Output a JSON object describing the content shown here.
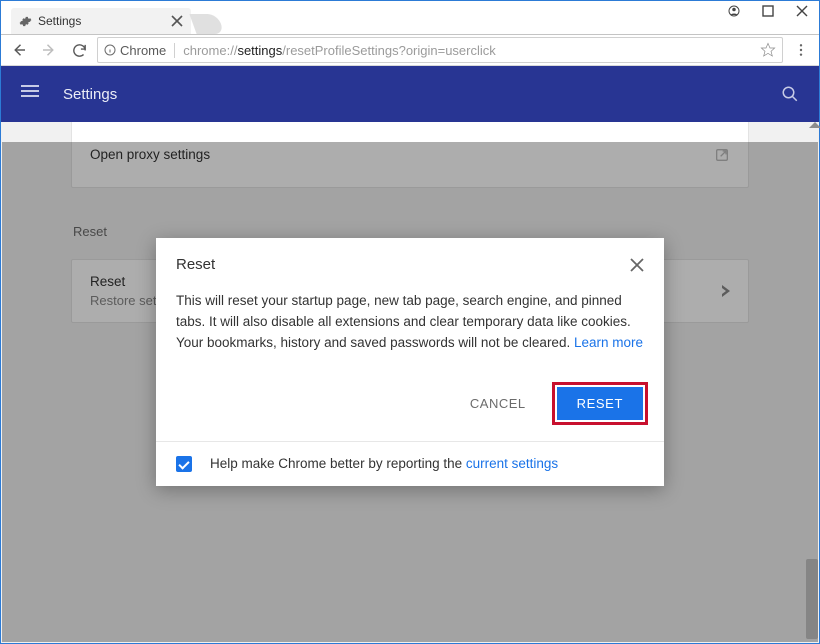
{
  "window_controls": {
    "profile": true,
    "minimize": false
  },
  "tab": {
    "title": "Settings"
  },
  "toolbar": {
    "site_label": "Chrome",
    "url_pre": "chrome://",
    "url_bold": "settings",
    "url_post": "/resetProfileSettings?origin=userclick"
  },
  "settings_bar": {
    "title": "Settings"
  },
  "content": {
    "proxy_label": "Open proxy settings",
    "section_label": "Reset",
    "reset_row": {
      "title": "Reset",
      "sub": "Restore set"
    }
  },
  "dialog": {
    "title": "Reset",
    "body": "This will reset your startup page, new tab page, search engine, and pinned tabs. It will also disable all extensions and clear temporary data like cookies. Your bookmarks, history and saved passwords will not be cleared. ",
    "learn_link": "Learn more",
    "cancel": "CANCEL",
    "reset": "RESET",
    "help_pre": "Help make Chrome better by reporting the ",
    "help_link": "current settings"
  }
}
